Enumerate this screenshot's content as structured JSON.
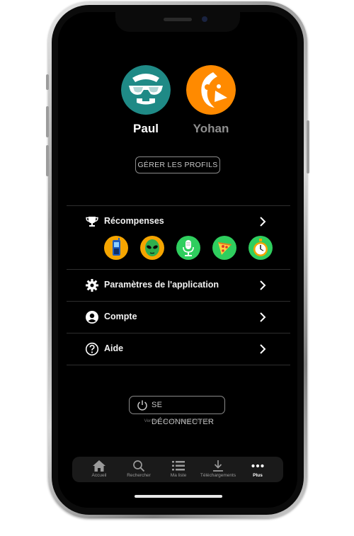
{
  "profiles": [
    {
      "name": "Paul",
      "icon": "sunglasses-face-icon",
      "color": "#1f8a86",
      "active": true
    },
    {
      "name": "Yohan",
      "icon": "orange-penguin-icon",
      "color": "#ff8a00",
      "active": false
    }
  ],
  "manage_profiles_label": "GÉRER LES PROFILS",
  "menu": {
    "rewards_label": "Récompenses",
    "settings_label": "Paramètres de l'application",
    "account_label": "Compte",
    "help_label": "Aide"
  },
  "badges": [
    {
      "icon": "phone-badge-icon",
      "color": "#f5a500"
    },
    {
      "icon": "alien-badge-icon",
      "color": "#f5a500"
    },
    {
      "icon": "microphone-badge-icon",
      "color": "#2fce5e"
    },
    {
      "icon": "pizza-badge-icon",
      "color": "#2fce5e"
    },
    {
      "icon": "stopwatch-badge-icon",
      "color": "#2fce5e"
    }
  ],
  "logout_label": "SE DÉCONNECTER",
  "version_text": "Version : 13.0.0 (3082) 5.0.2-002",
  "tabs": [
    {
      "label": "Accueil",
      "icon": "home-icon"
    },
    {
      "label": "Rechercher",
      "icon": "search-icon"
    },
    {
      "label": "Ma liste",
      "icon": "list-icon"
    },
    {
      "label": "Téléchargements",
      "icon": "download-icon"
    },
    {
      "label": "Plus",
      "icon": "more-icon",
      "active": true
    }
  ]
}
